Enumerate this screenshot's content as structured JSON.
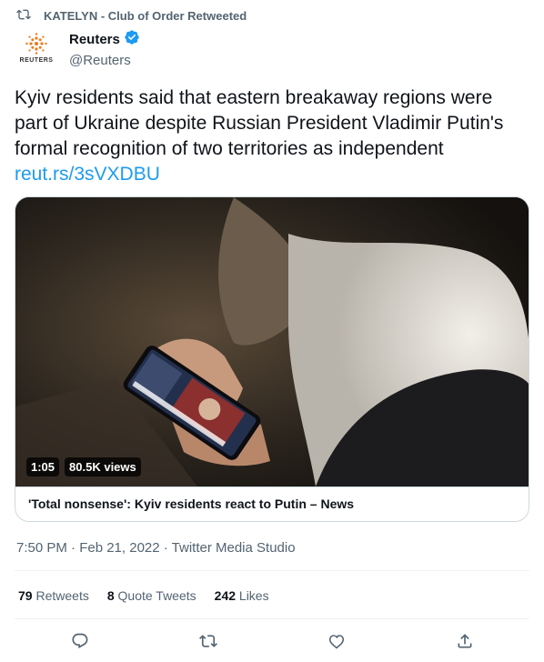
{
  "retweet": {
    "label": "KATELYN - Club of Order Retweeted"
  },
  "author": {
    "display_name": "Reuters",
    "handle": "@Reuters",
    "logo_text": "REUTERS",
    "verified": true
  },
  "tweet": {
    "text": "Kyiv residents said that eastern breakaway regions were part of Ukraine despite Russian President Vladimir Putin's formal recognition of two territories as independent",
    "link": "reut.rs/3sVXDBU"
  },
  "video": {
    "duration": "1:05",
    "views": "80.5K views",
    "title": "'Total nonsense': Kyiv residents react to Putin – News"
  },
  "meta": {
    "timestamp": "7:50 PM · Feb 21, 2022 · Twitter Media Studio"
  },
  "stats": {
    "retweets_count": "79",
    "retweets_label": "Retweets",
    "quotes_count": "8",
    "quotes_label": "Quote Tweets",
    "likes_count": "242",
    "likes_label": "Likes"
  },
  "colors": {
    "link": "#1d9bf0",
    "verified": "#1d9bf0",
    "secondary_text": "#536471",
    "border": "#cfd9de"
  },
  "icons": [
    "retweet-icon",
    "verified-icon",
    "reply-icon",
    "retweet-action-icon",
    "like-icon",
    "share-icon"
  ]
}
